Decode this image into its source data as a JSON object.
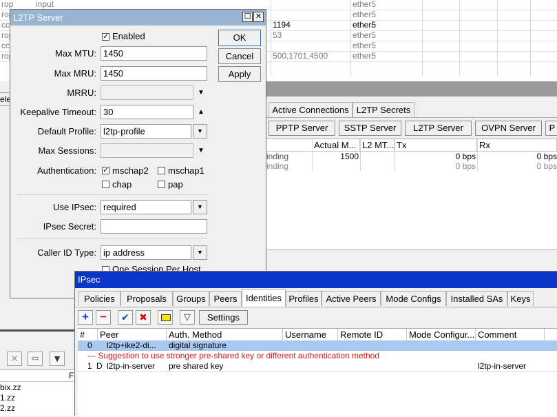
{
  "bg_table": {
    "rows": [
      {
        "c0": "rop",
        "c1": "input",
        "c2": "",
        "c3": "ether5"
      },
      {
        "c0": "rop",
        "c1": "",
        "c2": "",
        "c3": "ether5"
      },
      {
        "c0": "cce",
        "c1": "",
        "c2": "1194",
        "c3": "ether5"
      },
      {
        "c0": "rop",
        "c1": "",
        "c2": "53",
        "c3": "ether5"
      },
      {
        "c0": "cce",
        "c1": "",
        "c2": "",
        "c3": "ether5"
      },
      {
        "c0": "rop",
        "c1": "",
        "c2": "500,1701,4500",
        "c3": "ether5"
      }
    ],
    "left_fragment": "ele"
  },
  "ppp": {
    "tabs": [
      "Active Connections",
      "L2TP Secrets"
    ],
    "server_buttons": [
      "PPTP Server",
      "SSTP Server",
      "L2TP Server",
      "OVPN Server",
      "P"
    ],
    "columns": [
      "Actual M...",
      "L2 MT...",
      "Tx",
      "Rx"
    ],
    "rows": [
      {
        "status": "inding",
        "actual_mtu": "1500",
        "tx": "0 bps",
        "rx": "0 bps"
      },
      {
        "status": "inding",
        "actual_mtu": "",
        "tx": "0 bps",
        "rx": "0 bps"
      }
    ]
  },
  "bottom_left": {
    "header_fragment": "F",
    "items": [
      "bix.zz",
      "1.zz",
      "2.zz"
    ]
  },
  "l2tp": {
    "title": "L2TP Server",
    "enabled_label": "Enabled",
    "enabled": true,
    "ok": "OK",
    "cancel": "Cancel",
    "apply": "Apply",
    "max_mtu_label": "Max MTU:",
    "max_mtu": "1450",
    "max_mru_label": "Max MRU:",
    "max_mru": "1450",
    "mrru_label": "MRRU:",
    "mrru": "",
    "keepalive_label": "Keepalive Timeout:",
    "keepalive": "30",
    "default_profile_label": "Default Profile:",
    "default_profile": "l2tp-profile",
    "max_sessions_label": "Max Sessions:",
    "max_sessions": "",
    "auth_label": "Authentication:",
    "auth": {
      "mschap2": "mschap2",
      "mschap1": "mschap1",
      "chap": "chap",
      "pap": "pap"
    },
    "use_ipsec_label": "Use IPsec:",
    "use_ipsec": "required",
    "ipsec_secret_label": "IPsec Secret:",
    "ipsec_secret": "",
    "caller_id_label": "Caller ID Type:",
    "caller_id": "ip address",
    "one_session": "One Session Per Host"
  },
  "ipsec": {
    "title": "IPsec",
    "tabs": [
      "Policies",
      "Proposals",
      "Groups",
      "Peers",
      "Identities",
      "Profiles",
      "Active Peers",
      "Mode Configs",
      "Installed SAs",
      "Keys"
    ],
    "active_tab": "Identities",
    "settings": "Settings",
    "columns": [
      "#",
      "Peer",
      "Auth. Method",
      "Username",
      "Remote ID",
      "Mode Configur...",
      "Comment"
    ],
    "rows": [
      {
        "num": "0",
        "flag": "",
        "peer": "l2tp+ike2-di...",
        "auth": "digital signature",
        "comment": ""
      },
      {
        "num": "1",
        "flag": "D",
        "peer": "l2tp-in-server",
        "auth": "pre shared key",
        "comment": "l2tp-in-server"
      }
    ],
    "suggestion": "--- Suggestion to use stronger pre-shared key or different authentication method"
  },
  "colors": {
    "titlebar_l2tp": "#99b4d1",
    "titlebar_ipsec": "#0a35c9",
    "selection": "#a9c7ef",
    "warn": "#d11818",
    "dark_bar": "#505050"
  }
}
